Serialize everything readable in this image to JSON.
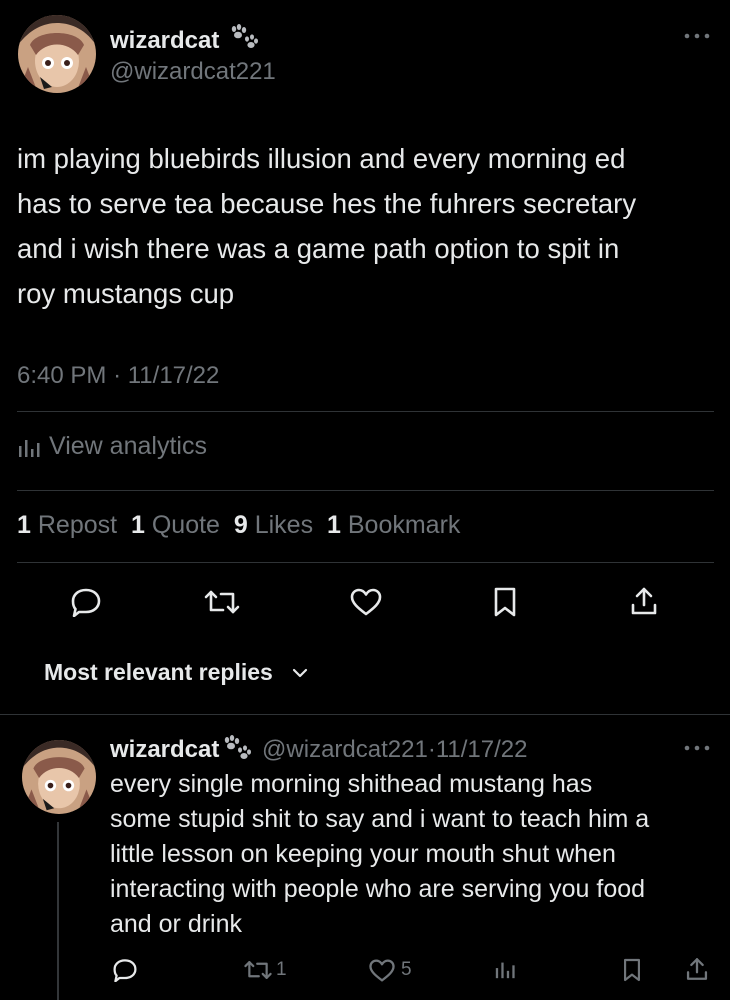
{
  "tweet": {
    "display_name": "wizardcat",
    "name_emoji_icon": "paw-prints-icon",
    "handle": "@wizardcat221",
    "text_lines": [
      "im playing bluebirds illusion and every morning ed",
      "has to serve tea because hes the fuhrers secretary",
      "and i wish there was a game path option to spit in",
      "roy mustangs cup"
    ],
    "time": "6:40 PM",
    "separator": "·",
    "date": "11/17/22",
    "analytics_label": "View analytics",
    "stats": {
      "reposts_count": "1",
      "reposts_label": "Repost",
      "quotes_count": "1",
      "quotes_label": "Quote",
      "likes_count": "9",
      "likes_label": "Likes",
      "bookmarks_count": "1",
      "bookmarks_label": "Bookmark"
    }
  },
  "replies_sort_label": "Most relevant replies",
  "reply": {
    "display_name": "wizardcat",
    "handle": "@wizardcat221",
    "separator": "·",
    "date": "11/17/22",
    "text_lines": [
      "every single morning shithead mustang has",
      "some stupid shit to say and i want to teach him a",
      "little lesson on keeping your mouth shut when",
      "interacting with people who are serving you food",
      "and or drink"
    ],
    "repost_count": "1",
    "like_count": "5"
  },
  "colors": {
    "background": "#000000",
    "text": "#e7e9ea",
    "muted": "#71767b",
    "divider": "#2f3336"
  }
}
